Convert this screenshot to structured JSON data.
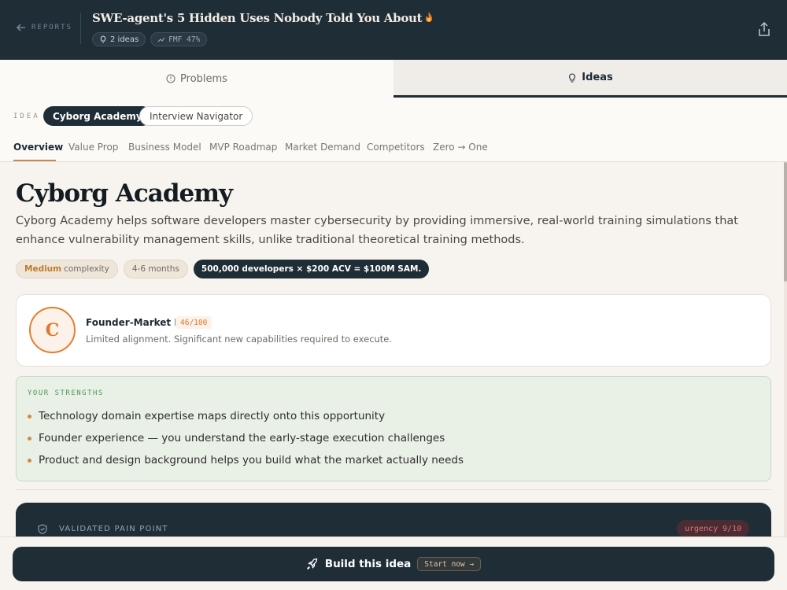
{
  "header": {
    "back_label": "REPORTS",
    "title": "SWE-agent's 5 Hidden Uses Nobody Told You About",
    "ideas_chip": "2 ideas",
    "fmf_chip": "FMF 47%"
  },
  "main_tabs": [
    {
      "label": "Problems",
      "active": false
    },
    {
      "label": "Ideas",
      "active": true
    }
  ],
  "idea_selector": {
    "label": "IDEA",
    "options": [
      "Cyborg Academy",
      "Interview Navigator"
    ],
    "selected": "Cyborg Academy"
  },
  "sub_tabs": [
    "Overview",
    "Value Prop",
    "Business Model",
    "MVP Roadmap",
    "Market Demand",
    "Competitors",
    "Zero → One"
  ],
  "overview": {
    "title": "Cyborg Academy",
    "description": "Cyborg Academy helps software developers master cybersecurity by providing immersive, real-world training simulations that enhance vulnerability management skills, unlike traditional theoretical training methods.",
    "complexity_level": "Medium",
    "complexity_suffix": "complexity",
    "duration": "4-6 months",
    "sam": "500,000 developers × $200 ACV = $100M SAM."
  },
  "founder_market_fit": {
    "grade": "C",
    "title": "Founder-Market Fit",
    "score": "46/100",
    "description": "Limited alignment. Significant new capabilities required to execute."
  },
  "strengths": {
    "label": "YOUR STRENGTHS",
    "items": [
      "Technology domain expertise maps directly onto this opportunity",
      "Founder experience — you understand the early-stage execution challenges",
      "Product and design background helps you build what the market actually needs"
    ]
  },
  "pain_point": {
    "label": "VALIDATED PAIN POINT",
    "urgency": "urgency 9/10"
  },
  "cta": {
    "label": "Build this idea",
    "chip": "Start now →"
  },
  "colors": {
    "navy": "#1f2d37",
    "accent_orange": "#e0772a",
    "strength_green": "#4e9a5a",
    "urgency_red": "#e6707a"
  }
}
